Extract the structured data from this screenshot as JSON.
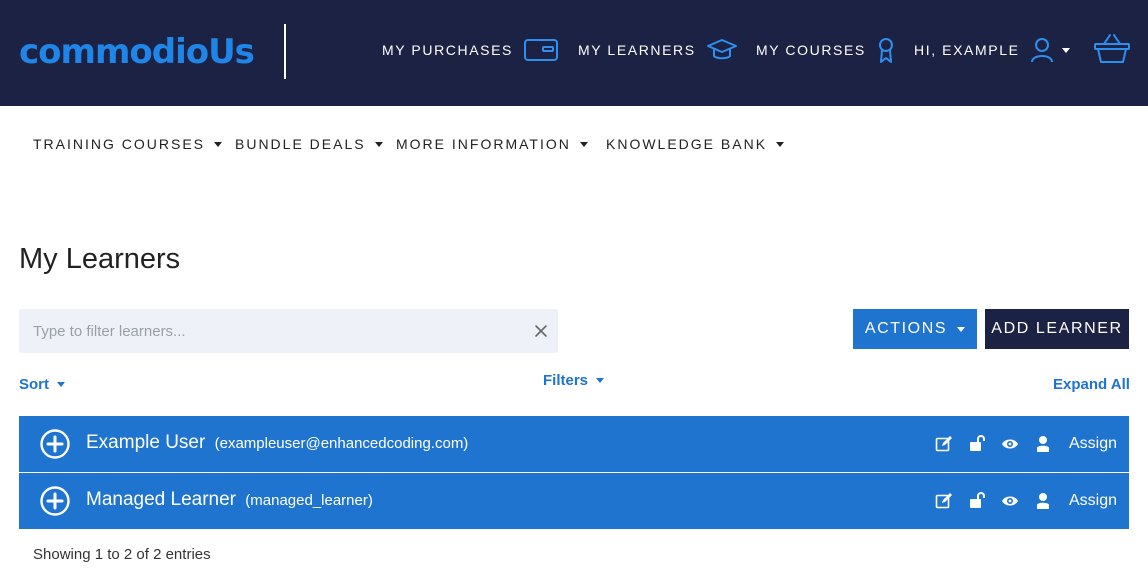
{
  "brand": {
    "logo_text": "commodioUs"
  },
  "topnav": {
    "purchases": "MY PURCHASES",
    "learners": "MY LEARNERS",
    "courses": "MY COURSES",
    "user": "HI, EXAMPLE"
  },
  "subnav": {
    "training": "TRAINING COURSES",
    "bundles": "BUNDLE DEALS",
    "more": "MORE INFORMATION",
    "knowledge": "KNOWLEDGE BANK"
  },
  "page": {
    "title": "My Learners",
    "filter_placeholder": "Type to filter learners...",
    "actions_label": "ACTIONS",
    "add_label": "ADD LEARNER",
    "sort_label": "Sort",
    "filters_label": "Filters",
    "expand_all_label": "Expand All",
    "entries_text": "Showing 1 to 2 of 2 entries"
  },
  "learners": [
    {
      "name": "Example User",
      "id": "(exampleuser@enhancedcoding.com)",
      "assign": "Assign"
    },
    {
      "name": "Managed Learner",
      "id": "(managed_learner)",
      "assign": "Assign"
    }
  ],
  "colors": {
    "navy": "#1c2244",
    "primary_blue": "#1f74cf",
    "logo_blue": "#1f86e8",
    "icon_blue": "#2e8fef",
    "filter_bg": "#eef2f8"
  },
  "icons": {
    "purchases": "wallet-icon",
    "learners": "graduation-cap-icon",
    "courses": "award-ribbon-icon",
    "user": "user-icon",
    "cart": "basket-icon",
    "row_edit": "edit-icon",
    "row_unlock": "unlock-icon",
    "row_view": "eye-icon",
    "row_user": "user-solid-icon"
  }
}
